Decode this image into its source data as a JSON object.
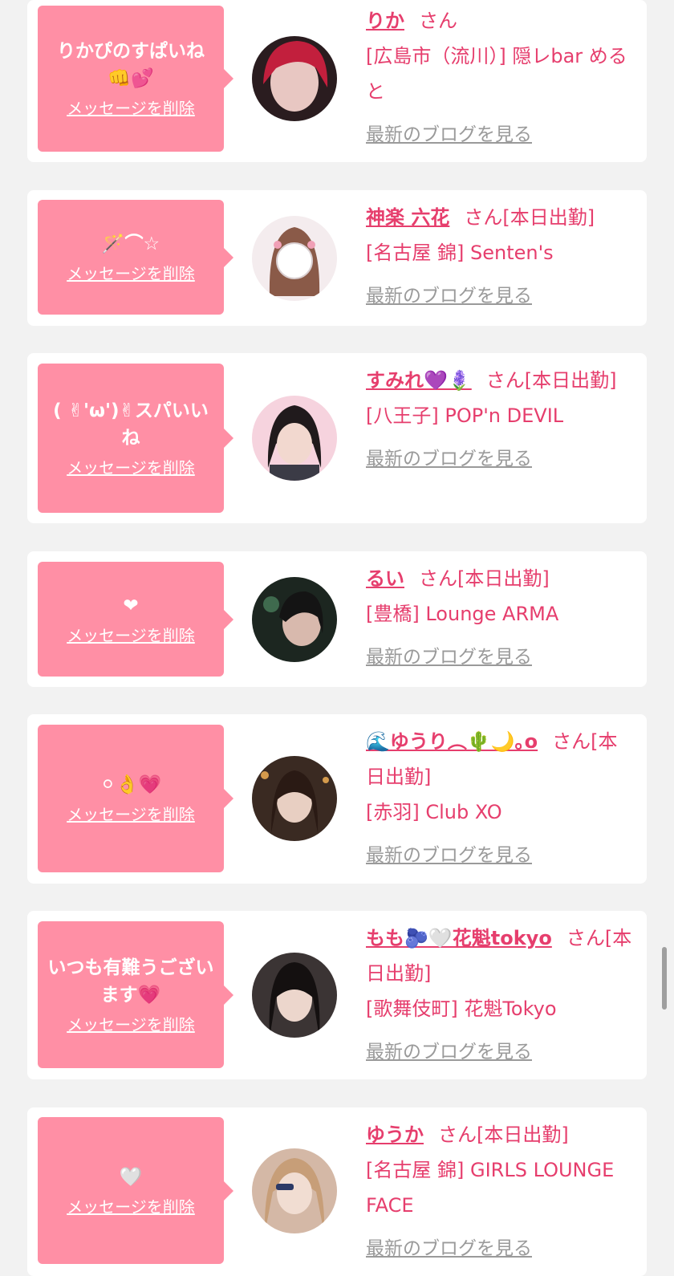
{
  "messages": [
    {
      "message": "りかぴのすぱいね👊💕",
      "delete_label": "メッセージを削除",
      "name": "りか",
      "suffix": "さん",
      "shop": "[広島市（流川）] 隠レbar めると",
      "blog_label": "最新のブログを見る"
    },
    {
      "message": "🪄⌒☆",
      "delete_label": "メッセージを削除",
      "name": "神楽 六花",
      "suffix": "さん[本日出勤]",
      "shop": "[名古屋 錦] Senten's",
      "blog_label": "最新のブログを見る"
    },
    {
      "message": "( ✌︎'ω')✌︎スパいいね",
      "delete_label": "メッセージを削除",
      "name": "すみれ💜🪻",
      "suffix": "さん[本日出勤]",
      "shop": "[八王子] POP'n DEVIL",
      "blog_label": "最新のブログを見る"
    },
    {
      "message": "❤",
      "delete_label": "メッセージを削除",
      "name": "るい",
      "suffix": "さん[本日出勤]",
      "shop": "[豊橋] Lounge ARMA",
      "blog_label": "最新のブログを見る"
    },
    {
      "message": "⚪︎👌💗",
      "delete_label": "メッセージを削除",
      "name": "🌊ゆうり︵🌵🌙｡o",
      "suffix": "さん[本日出勤]",
      "shop": "[赤羽] Club XO",
      "blog_label": "最新のブログを見る"
    },
    {
      "message": "いつも有難うございます💗",
      "delete_label": "メッセージを削除",
      "name": "もも🫐🤍花魁tokyo",
      "suffix": "さん[本日出勤]",
      "shop": "[歌舞伎町] 花魁Tokyo",
      "blog_label": "最新のブログを見る"
    },
    {
      "message": "🤍",
      "delete_label": "メッセージを削除",
      "name": "ゆうか",
      "suffix": "さん[本日出勤]",
      "shop": "[名古屋 錦] GIRLS LOUNGE FACE",
      "blog_label": "最新のブログを見る"
    }
  ],
  "avatar_colors": [
    "#b8243a",
    "#f3e6ea",
    "#f0c6d2",
    "#1f2a24",
    "#3a2a22",
    "#2b2424",
    "#c9a98f"
  ]
}
